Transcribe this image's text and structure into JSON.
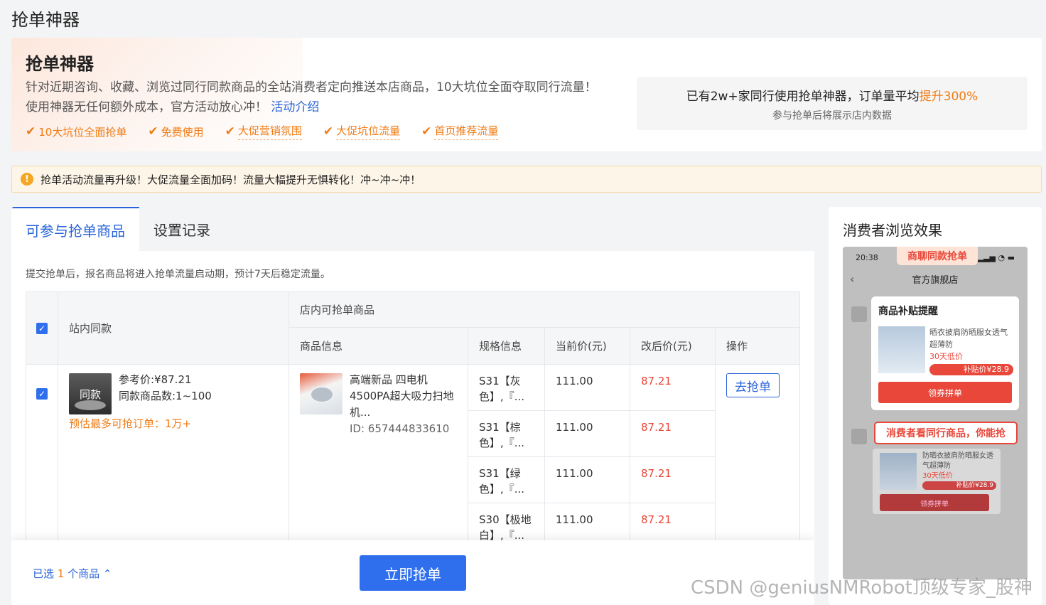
{
  "page": {
    "title": "抢单神器"
  },
  "hero": {
    "title": "抢单神器",
    "desc_line1": "针对近期咨询、收藏、浏览过同行同款商品的全站消费者定向推送本店商品，10大坑位全面夺取同行流量！",
    "desc_line2": "使用神器无任何额外成本，官方活动放心冲！",
    "activity_link": "活动介绍",
    "features": [
      "10大坑位全面抢单",
      "免费使用",
      "大促营销氛围",
      "大促坑位流量",
      "首页推荐流量"
    ],
    "stats_prefix": "已有2w+家同行使用抢单神器，订单量平均",
    "stats_highlight": "提升300%",
    "stats_sub": "参与抢单后将展示店内数据"
  },
  "notice": {
    "text": "抢单活动流量再升级！大促流量全面加码！流量大幅提升无惧转化！冲~冲~冲！"
  },
  "tabs": [
    "可参与抢单商品",
    "设置记录"
  ],
  "tip": "提交抢单后，报名商品将进入抢单流量启动期，预计7天后稳定流量。",
  "table": {
    "header_site": "站内同款",
    "header_store": "店内可抢单商品",
    "sub_headers": [
      "商品信息",
      "规格信息",
      "当前价(元)",
      "改后价(元)",
      "操作"
    ]
  },
  "row": {
    "site_thumb_label": "同款",
    "ref_price": "参考价:¥87.21",
    "same_count": "同款商品数:1~100",
    "estimate": "预估最多可抢订单：1万+",
    "product_name": "高端新品 四电机4500PA超大吸力扫地机...",
    "product_id": "ID: 657444833610",
    "action": "去抢单",
    "skus": [
      {
        "spec": "S31【灰色】,『...",
        "cur": "111.00",
        "new": "87.21"
      },
      {
        "spec": "S31【棕色】,『...",
        "cur": "111.00",
        "new": "87.21"
      },
      {
        "spec": "S31【绿色】,『...",
        "cur": "111.00",
        "new": "87.21"
      },
      {
        "spec": "S30【极地白】,『...",
        "cur": "111.00",
        "new": "87.21"
      }
    ]
  },
  "footer": {
    "selected_prefix": "已选",
    "selected_count": "1",
    "selected_suffix": "个商品",
    "submit": "立即抢单"
  },
  "side": {
    "title": "消费者浏览效果",
    "time": "20:38",
    "tag": "商聊同款抢单",
    "shop": "官方旗舰店",
    "popup_title": "商品补贴提醒",
    "product_text": "晒衣披肩防晒服女透气超薄防",
    "low_label": "30天低价",
    "sub_price": "补贴价¥28.9",
    "popup_btn": "领券拼单",
    "callout": "消费者看同行商品，你能抢",
    "card2_text": "防晒衣披肩防晒服女透气超薄防",
    "card2_low": "30天低价",
    "card2_price": "补贴价¥28.9",
    "card2_btn": "领券拼单"
  },
  "watermark": "CSDN @geniusNMRobot顶级专家_股神"
}
